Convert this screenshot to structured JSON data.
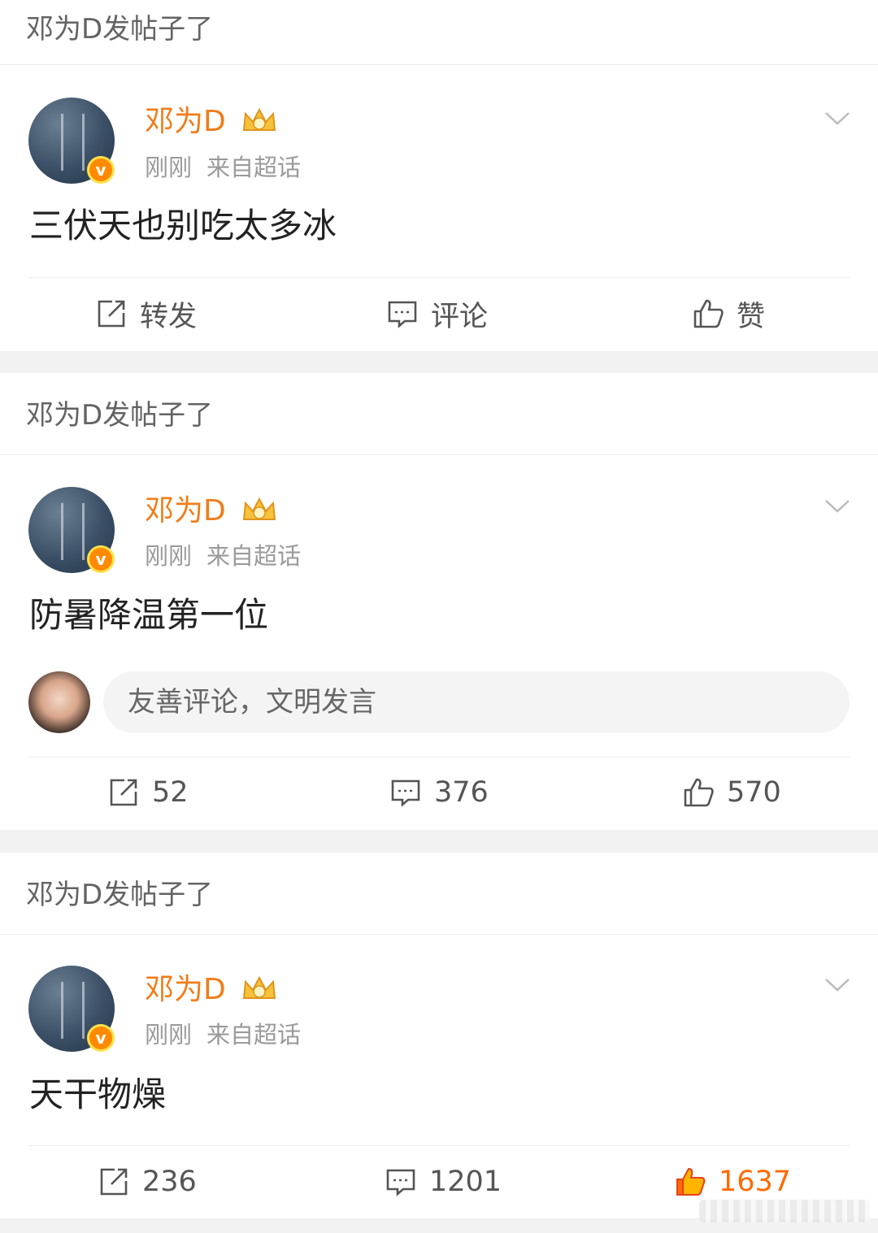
{
  "posts": [
    {
      "header": "邓为D发帖子了",
      "author": "邓为D",
      "time": "刚刚",
      "source": "来自超话",
      "content": "三伏天也别吃太多冰",
      "actions": {
        "repost": "转发",
        "comment": "评论",
        "like": "赞"
      },
      "liked": false
    },
    {
      "header": "邓为D发帖子了",
      "author": "邓为D",
      "time": "刚刚",
      "source": "来自超话",
      "content": "防暑降温第一位",
      "comment_placeholder": "友善评论，文明发言",
      "actions": {
        "repost": "52",
        "comment": "376",
        "like": "570"
      },
      "liked": false
    },
    {
      "header": "邓为D发帖子了",
      "author": "邓为D",
      "time": "刚刚",
      "source": "来自超话",
      "content": "天干物燥",
      "actions": {
        "repost": "236",
        "comment": "1201",
        "like": "1637"
      },
      "liked": true
    }
  ],
  "colors": {
    "username": "#f07d1a",
    "liked": "#ff6a00",
    "icon": "#555555",
    "separator": "#f2f2f2"
  }
}
